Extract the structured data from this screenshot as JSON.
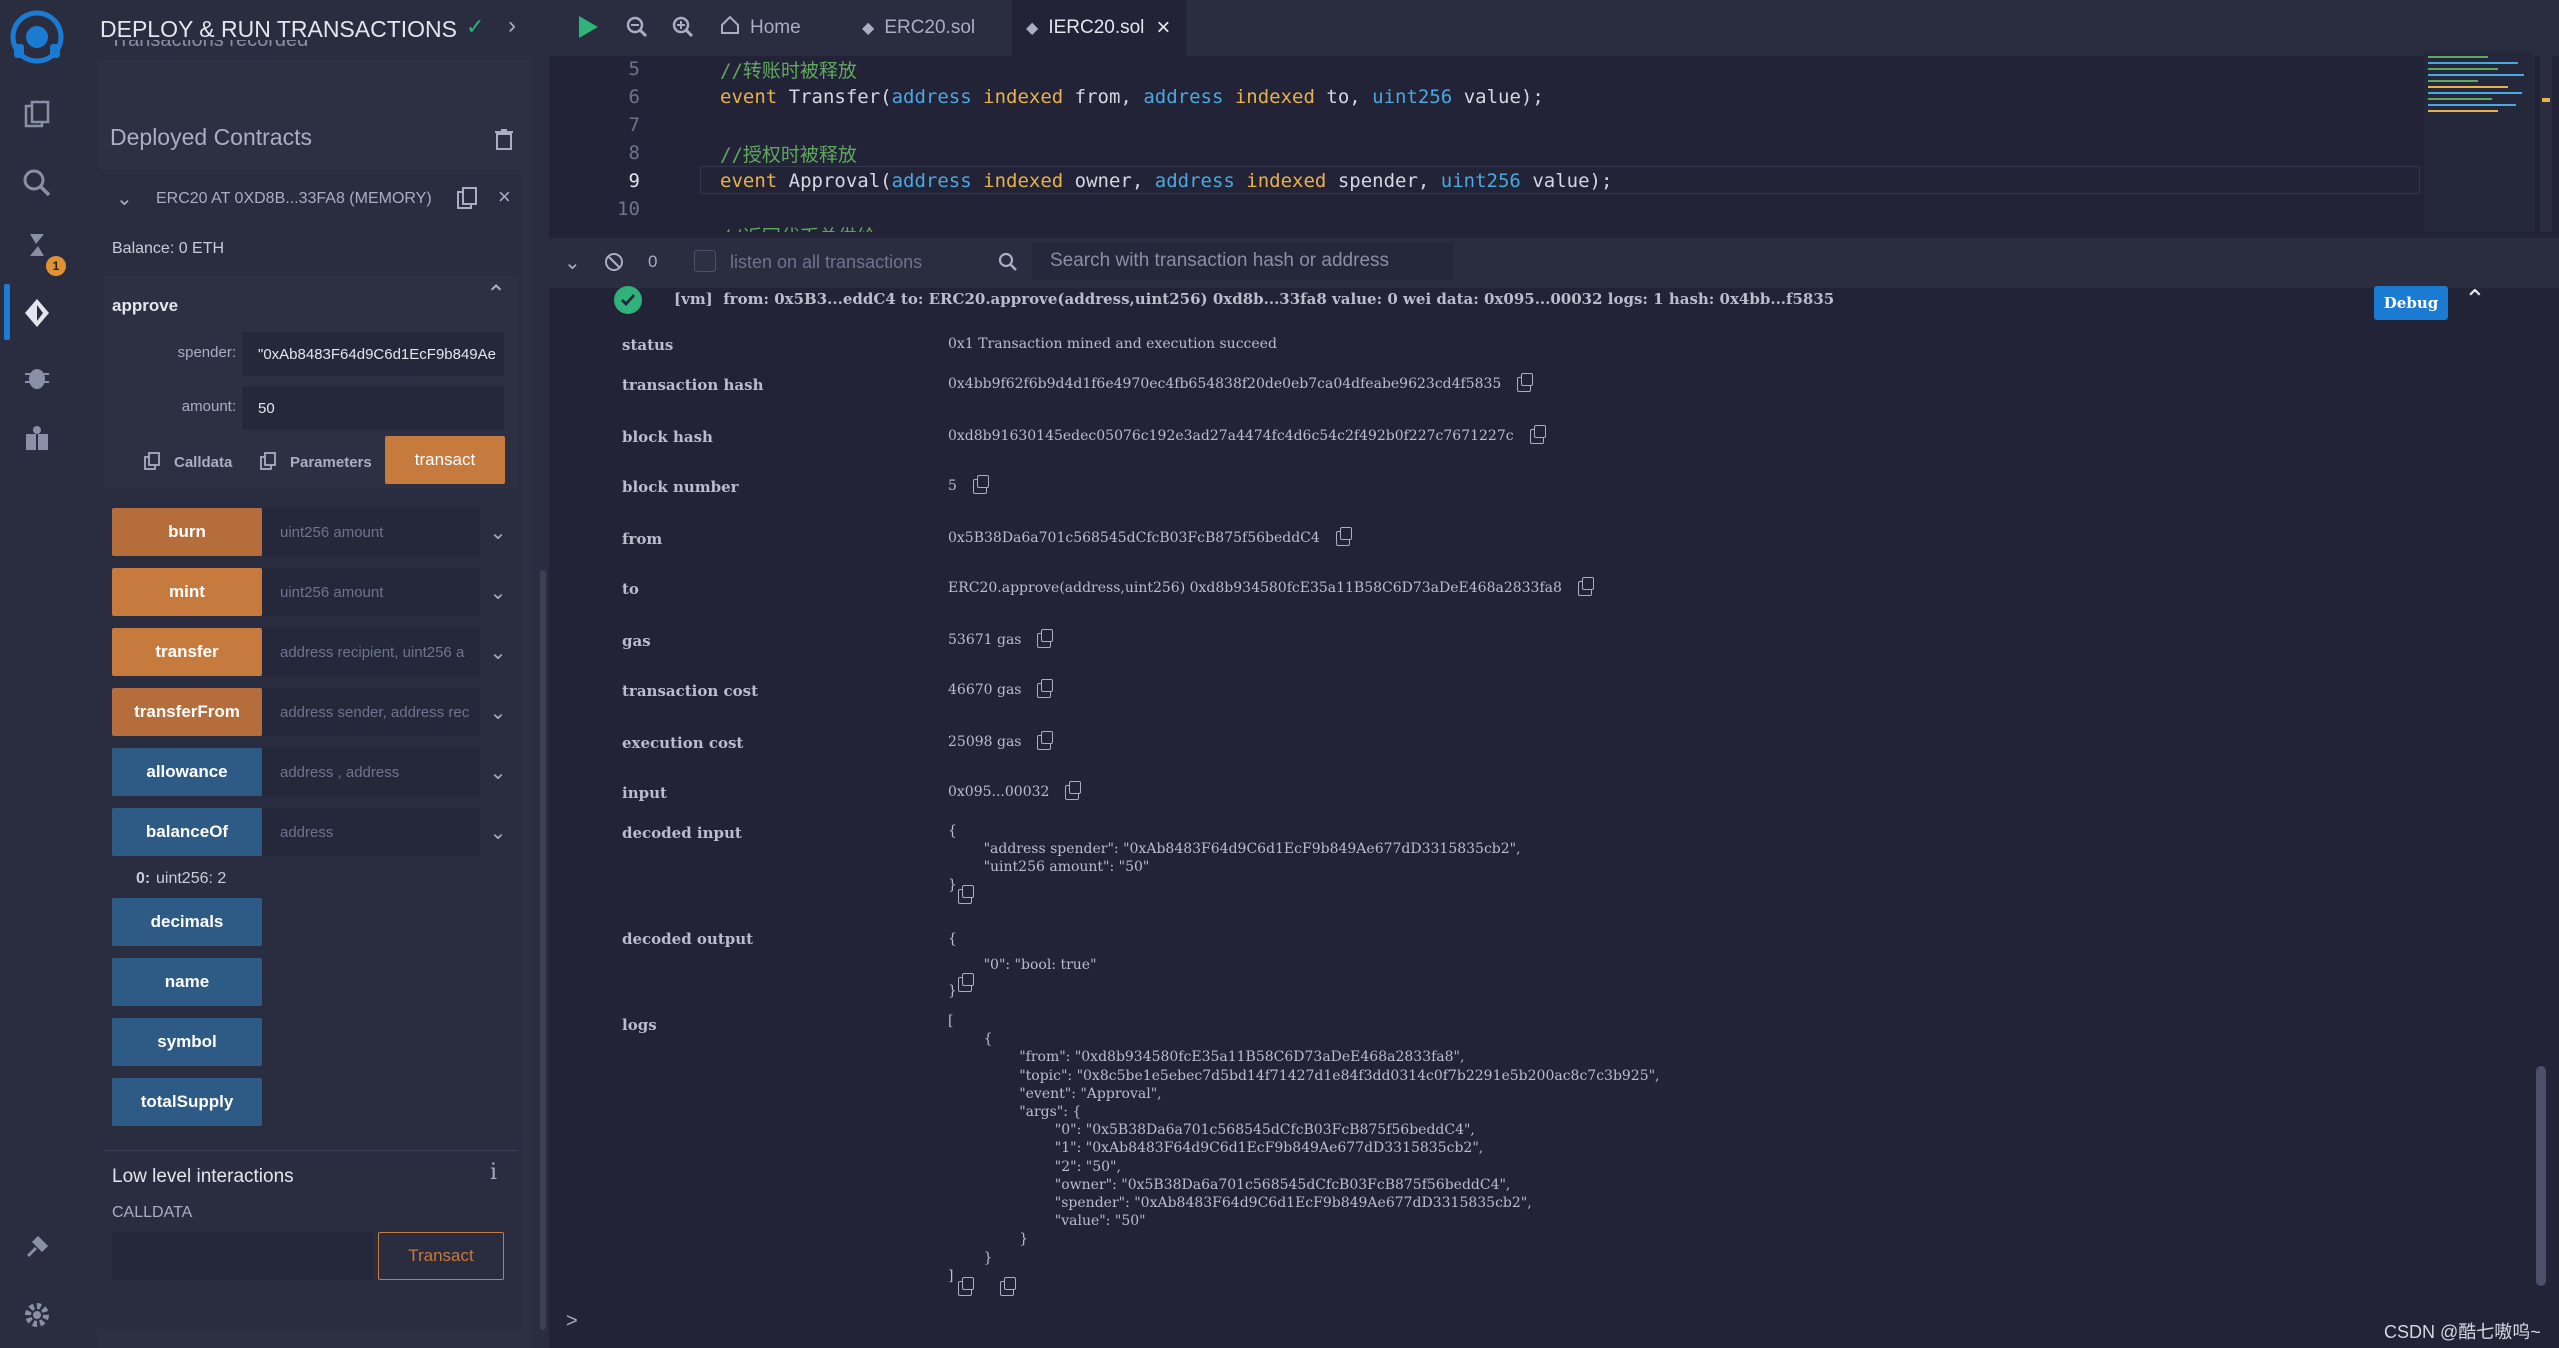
{
  "sidebar_panel": {
    "title": "DEPLOY & RUN TRANSACTIONS",
    "truncated_header": "Transactions recorded",
    "deployed_contracts_label": "Deployed Contracts",
    "contract_name": "ERC20 AT 0XD8B...33FA8 (MEMORY)",
    "balance": "Balance: 0 ETH",
    "approve": {
      "label": "approve",
      "spender_label": "spender:",
      "spender_value": "\"0xAb8483F64d9C6d1EcF9b849Ae",
      "amount_label": "amount:",
      "amount_value": "50",
      "calldata_label": "Calldata",
      "parameters_label": "Parameters",
      "transact_label": "transact"
    },
    "functions": [
      {
        "name": "burn",
        "placeholder": "uint256 amount"
      },
      {
        "name": "mint",
        "placeholder": "uint256 amount"
      },
      {
        "name": "transfer",
        "placeholder": "address recipient, uint256 a"
      },
      {
        "name": "transferFrom",
        "placeholder": "address sender, address rec"
      },
      {
        "name": "allowance",
        "placeholder": "address , address"
      },
      {
        "name": "balanceOf",
        "placeholder": "address"
      }
    ],
    "balance_result_index": "0:",
    "balance_result_value": "uint256: 2",
    "view_functions": [
      "decimals",
      "name",
      "symbol",
      "totalSupply"
    ],
    "low_level_label": "Low level interactions",
    "info_label": "i",
    "calldata_caption": "CALLDATA",
    "low_level_transact": "Transact"
  },
  "tabs": [
    {
      "label": "Home"
    },
    {
      "label": "ERC20.sol"
    },
    {
      "label": "IERC20.sol"
    }
  ],
  "code": {
    "line_numbers": [
      "5",
      "6",
      "7",
      "8",
      "9",
      "10"
    ],
    "comment1": "//转账时被释放",
    "l6_kw": "event",
    "l6_name": "Transfer(",
    "l6_t1": "address",
    "l6_i1": "indexed",
    "l6_p1": "from,",
    "l6_t2": "address",
    "l6_i2": "indexed",
    "l6_p2": "to,",
    "l6_t3": "uint256",
    "l6_p3": "value);",
    "comment2": "//授权时被释放",
    "l9_kw": "event",
    "l9_name": "Approval(",
    "l9_t1": "address",
    "l9_i1": "indexed",
    "l9_p1": "owner,",
    "l9_t2": "address",
    "l9_i2": "indexed",
    "l9_p2": "spender,",
    "l9_t3": "uint256",
    "l9_p3": "value);",
    "comment3": "//返回代币总供给"
  },
  "terminal": {
    "count": "0",
    "listen_label": "listen on all transactions",
    "search_placeholder": "Search with transaction hash or address",
    "summary": "[vm]  from: 0x5B3...eddC4 to: ERC20.approve(address,uint256) 0xd8b...33fa8 value: 0 wei data: 0x095...00032 logs: 1 hash: 0x4bb...f5835",
    "debug_label": "Debug",
    "rows": [
      {
        "key": "status",
        "value": "0x1 Transaction mined and execution succeed"
      },
      {
        "key": "transaction hash",
        "value": "0x4bb9f62f6b9d4d1f6e4970ec4fb654838f20de0eb7ca04dfeabe9623cd4f5835"
      },
      {
        "key": "block hash",
        "value": "0xd8b91630145edec05076c192e3ad27a4474fc4d6c54c2f492b0f227c7671227c"
      },
      {
        "key": "block number",
        "value": "5"
      },
      {
        "key": "from",
        "value": "0x5B38Da6a701c568545dCfcB03FcB875f56beddC4"
      },
      {
        "key": "to",
        "value": "ERC20.approve(address,uint256) 0xd8b934580fcE35a11B58C6D73aDeE468a2833fa8"
      },
      {
        "key": "gas",
        "value": "53671 gas"
      },
      {
        "key": "transaction cost",
        "value": "46670 gas"
      },
      {
        "key": "execution cost",
        "value": "25098 gas"
      },
      {
        "key": "input",
        "value": "0x095...00032"
      }
    ],
    "decoded_input_key": "decoded input",
    "decoded_input": "{\n        \"address spender\": \"0xAb8483F64d9C6d1EcF9b849Ae677dD3315835cb2\",\n        \"uint256 amount\": \"50\"\n}",
    "decoded_output_key": "decoded output",
    "decoded_output": "{\n        \"0\": \"bool: true\"\n}",
    "logs_key": "logs",
    "logs": "[\n        {\n                \"from\": \"0xd8b934580fcE35a11B58C6D73aDeE468a2833fa8\",\n                \"topic\": \"0x8c5be1e5ebec7d5bd14f71427d1e84f3dd0314c0f7b2291e5b200ac8c7c3b925\",\n                \"event\": \"Approval\",\n                \"args\": {\n                        \"0\": \"0x5B38Da6a701c568545dCfcB03FcB875f56beddC4\",\n                        \"1\": \"0xAb8483F64d9C6d1EcF9b849Ae677dD3315835cb2\",\n                        \"2\": \"50\",\n                        \"owner\": \"0x5B38Da6a701c568545dCfcB03FcB875f56beddC4\",\n                        \"spender\": \"0xAb8483F64d9C6d1EcF9b849Ae677dD3315835cb2\",\n                        \"value\": \"50\"\n                }\n        }\n]",
    "prompt": ">"
  },
  "watermark": "CSDN @酷七嗷呜~",
  "badge_count": "1",
  "colors": {
    "accent_orange": "#c77a3d",
    "accent_blue": "#2e5a86",
    "success_green": "#2fb37a",
    "debug_blue": "#1b7bd2"
  }
}
